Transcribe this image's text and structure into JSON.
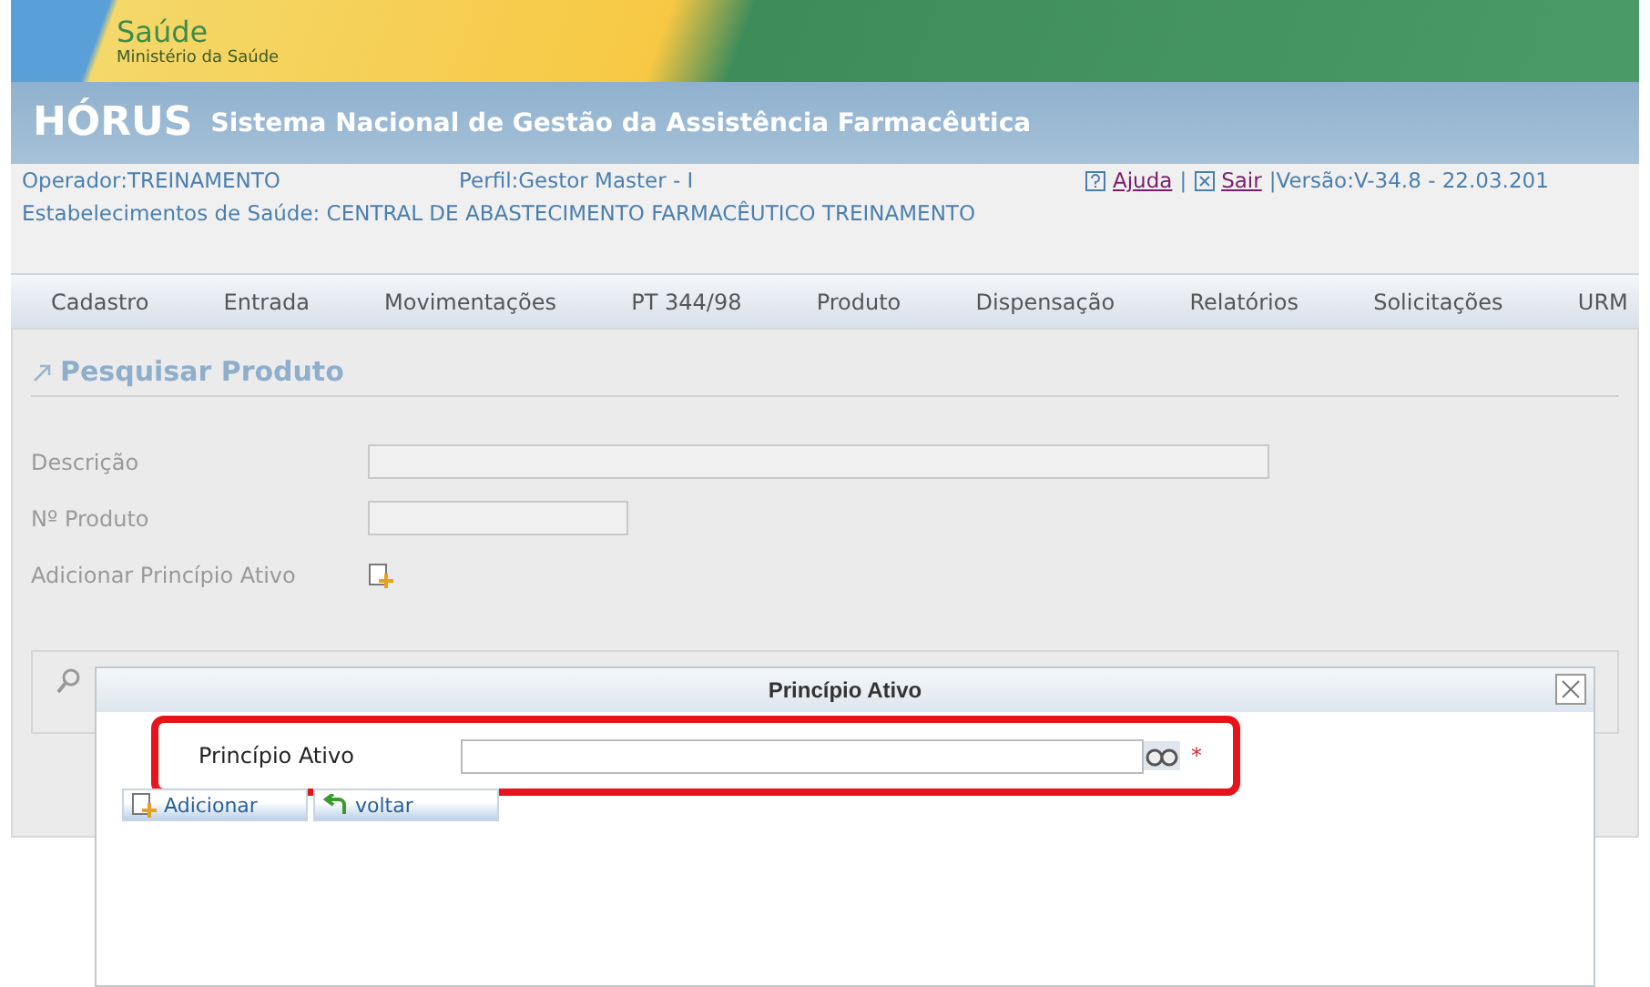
{
  "brand": {
    "name": "Saúde",
    "ministry": "Ministério da Saúde"
  },
  "header": {
    "system": "HÓRUS",
    "subtitle": "Sistema Nacional de Gestão da Assistência Farmacêutica"
  },
  "user_info": {
    "operator": "Operador:TREINAMENTO",
    "profile": "Perfil:Gestor Master - I",
    "help_link": "Ajuda",
    "separator": "|",
    "exit_link": "Sair",
    "version": "|Versão:V-34.8 - 22.03.201",
    "establishment": "Estabelecimentos de Saúde: CENTRAL DE ABASTECIMENTO FARMACÊUTICO TREINAMENTO"
  },
  "menu": [
    {
      "label": "Cadastro"
    },
    {
      "label": "Entrada"
    },
    {
      "label": "Movimentações"
    },
    {
      "label": "PT 344/98"
    },
    {
      "label": "Produto"
    },
    {
      "label": "Dispensação"
    },
    {
      "label": "Relatórios"
    },
    {
      "label": "Solicitações"
    },
    {
      "label": "URM"
    }
  ],
  "page": {
    "title": "Pesquisar Produto",
    "fields": [
      {
        "label": "Descrição",
        "kind": "wide"
      },
      {
        "label": "Nº Produto",
        "kind": "short"
      },
      {
        "label": "Adicionar Princípio Ativo",
        "kind": "add"
      }
    ]
  },
  "dialog": {
    "title": "Princípio Ativo",
    "field_label": "Princípio Ativo",
    "required_mark": "*",
    "buttons": [
      {
        "label": "Adicionar",
        "kind": "add"
      },
      {
        "label": "voltar",
        "kind": "back"
      }
    ]
  }
}
